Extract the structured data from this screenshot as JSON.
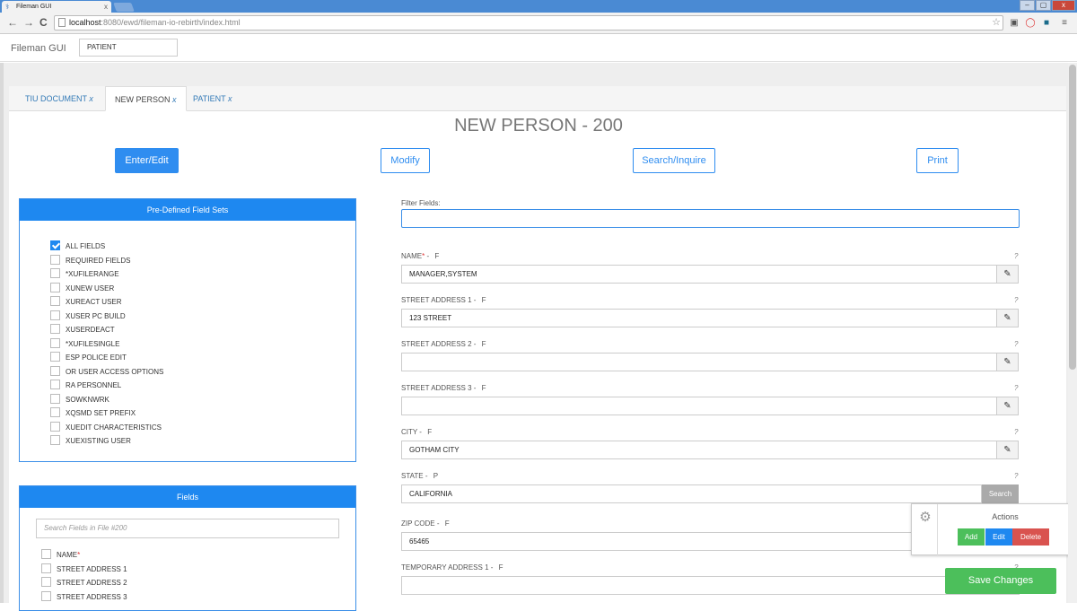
{
  "browser": {
    "tab_title": "Fileman GUI",
    "tab_close": "x",
    "url_host": "localhost",
    "url_path": ":8080/ewd/fileman-io-rebirth/index.html",
    "back": "←",
    "forward": "→",
    "reload": "C",
    "minimize": "–",
    "maximize": "▢",
    "close": "x",
    "star": "☆",
    "menu": "≡"
  },
  "app": {
    "title": "Fileman GUI",
    "patient_value": "PATIENT"
  },
  "tabs": [
    {
      "label": "TIU DOCUMENT",
      "close": "x"
    },
    {
      "label": "NEW PERSON",
      "close": "x"
    },
    {
      "label": "PATIENT",
      "close": "x"
    }
  ],
  "heading": "NEW PERSON - 200",
  "buttons": {
    "enter_edit": "Enter/Edit",
    "modify": "Modify",
    "search_inquire": "Search/Inquire",
    "print": "Print"
  },
  "field_sets": {
    "title": "Pre-Defined Field Sets",
    "items": [
      {
        "label": "ALL FIELDS",
        "checked": true
      },
      {
        "label": "REQUIRED FIELDS",
        "checked": false
      },
      {
        "label": "*XUFILERANGE",
        "checked": false
      },
      {
        "label": "XUNEW USER",
        "checked": false
      },
      {
        "label": "XUREACT USER",
        "checked": false
      },
      {
        "label": "XUSER PC BUILD",
        "checked": false
      },
      {
        "label": "XUSERDEACT",
        "checked": false
      },
      {
        "label": "*XUFILESINGLE",
        "checked": false
      },
      {
        "label": "ESP POLICE EDIT",
        "checked": false
      },
      {
        "label": "OR USER ACCESS OPTIONS",
        "checked": false
      },
      {
        "label": "RA PERSONNEL",
        "checked": false
      },
      {
        "label": "SOWKNWRK",
        "checked": false
      },
      {
        "label": "XQSMD SET PREFIX",
        "checked": false
      },
      {
        "label": "XUEDIT CHARACTERISTICS",
        "checked": false
      },
      {
        "label": "XUEXISTING USER",
        "checked": false
      }
    ]
  },
  "fields_card": {
    "title": "Fields",
    "search_placeholder": "Search Fields in File #200",
    "items": [
      {
        "label": "NAME",
        "required": "*"
      },
      {
        "label": "STREET ADDRESS 1",
        "required": ""
      },
      {
        "label": "STREET ADDRESS 2",
        "required": ""
      },
      {
        "label": "STREET ADDRESS 3",
        "required": ""
      }
    ]
  },
  "filter": {
    "label": "Filter Fields:",
    "value": ""
  },
  "form_fields": [
    {
      "label": "NAME",
      "required": "*",
      "type": "F",
      "value": "MANAGER,SYSTEM",
      "help": "?",
      "action": "edit"
    },
    {
      "label": "STREET ADDRESS 1",
      "required": "",
      "type": "F",
      "value": "123 STREET",
      "help": "?",
      "action": "edit"
    },
    {
      "label": "STREET ADDRESS 2",
      "required": "",
      "type": "F",
      "value": "",
      "help": "?",
      "action": "edit"
    },
    {
      "label": "STREET ADDRESS 3",
      "required": "",
      "type": "F",
      "value": "",
      "help": "?",
      "action": "edit"
    },
    {
      "label": "CITY",
      "required": "",
      "type": "F",
      "value": "GOTHAM CITY",
      "help": "?",
      "action": "edit"
    },
    {
      "label": "STATE",
      "required": "",
      "type": "P",
      "value": "CALIFORNIA",
      "help": "?",
      "action": "search",
      "action_label": "Search"
    },
    {
      "label": "ZIP CODE",
      "required": "",
      "type": "F",
      "value": "65465",
      "help": "?",
      "action": "none"
    },
    {
      "label": "TEMPORARY ADDRESS 1",
      "required": "",
      "type": "F",
      "value": "",
      "help": "?",
      "action": "none"
    }
  ],
  "actions": {
    "title": "Actions",
    "add": "Add",
    "edit": "Edit",
    "delete": "Delete"
  },
  "save": "Save Changes",
  "colors": {
    "primary": "#1e88f0",
    "success": "#4cbf5b",
    "danger": "#d9534f",
    "link": "#337ab7"
  }
}
